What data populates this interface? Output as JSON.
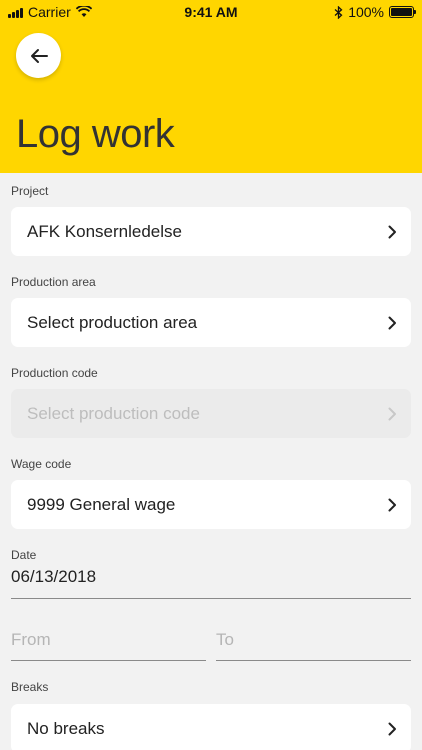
{
  "status_bar": {
    "carrier": "Carrier",
    "time": "9:41 AM",
    "battery": "100%",
    "battery_level": 1.0
  },
  "header": {
    "title": "Log work",
    "back_icon": "arrow-left-icon",
    "background_color": "#ffd600"
  },
  "form": {
    "project": {
      "label": "Project",
      "value": "AFK Konsernledelse"
    },
    "production_area": {
      "label": "Production area",
      "value": "Select production area"
    },
    "production_code": {
      "label": "Production code",
      "value": "Select production code",
      "disabled": true
    },
    "wage_code": {
      "label": "Wage code",
      "value": "9999 General wage"
    },
    "date": {
      "label": "Date",
      "value": "06/13/2018"
    },
    "from": {
      "placeholder": "From"
    },
    "to": {
      "placeholder": "To"
    },
    "breaks": {
      "label": "Breaks",
      "value": "No breaks"
    }
  }
}
